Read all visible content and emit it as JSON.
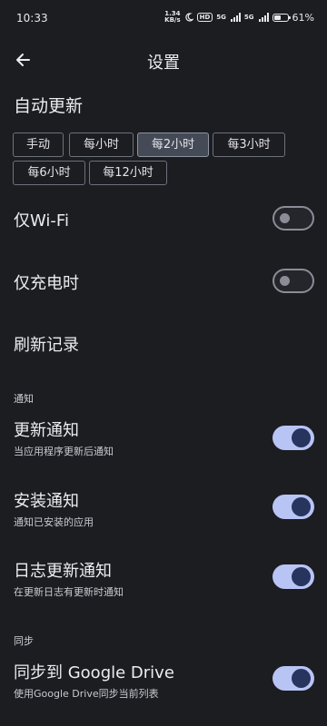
{
  "status_bar": {
    "time": "10:33",
    "net_speed_value": "1.34",
    "net_speed_unit": "KB/s",
    "hd_label": "HD",
    "sim1_label": "5G",
    "sim2_label": "5G",
    "battery_percent_text": "61",
    "battery_level": 0.61
  },
  "app_bar": {
    "back_icon": "arrow-left-icon",
    "title": "设置"
  },
  "auto_update": {
    "title": "自动更新",
    "options": [
      "手动",
      "每小时",
      "每2小时",
      "每3小时",
      "每6小时",
      "每12小时"
    ],
    "selected": "每2小时"
  },
  "wifi_only": {
    "title": "仅Wi-Fi",
    "enabled": false
  },
  "charging_only": {
    "title": "仅充电时",
    "enabled": false
  },
  "refresh_log": {
    "title": "刷新记录"
  },
  "notifications": {
    "category": "通知",
    "update": {
      "title": "更新通知",
      "subtitle": "当应用程序更新后通知",
      "enabled": true
    },
    "install": {
      "title": "安装通知",
      "subtitle": "通知已安装的应用",
      "enabled": true
    },
    "changelog": {
      "title": "日志更新通知",
      "subtitle": "在更新日志有更新时通知",
      "enabled": true
    }
  },
  "sync": {
    "category": "同步",
    "google_drive": {
      "title": "同步到 Google Drive",
      "subtitle": "使用Google Drive同步当前列表",
      "enabled": true
    }
  },
  "colors": {
    "background": "#1c1d21",
    "toggle_on_track": "#b8c4f4",
    "toggle_on_knob": "#27345e",
    "chip_selected": "#454a57"
  }
}
